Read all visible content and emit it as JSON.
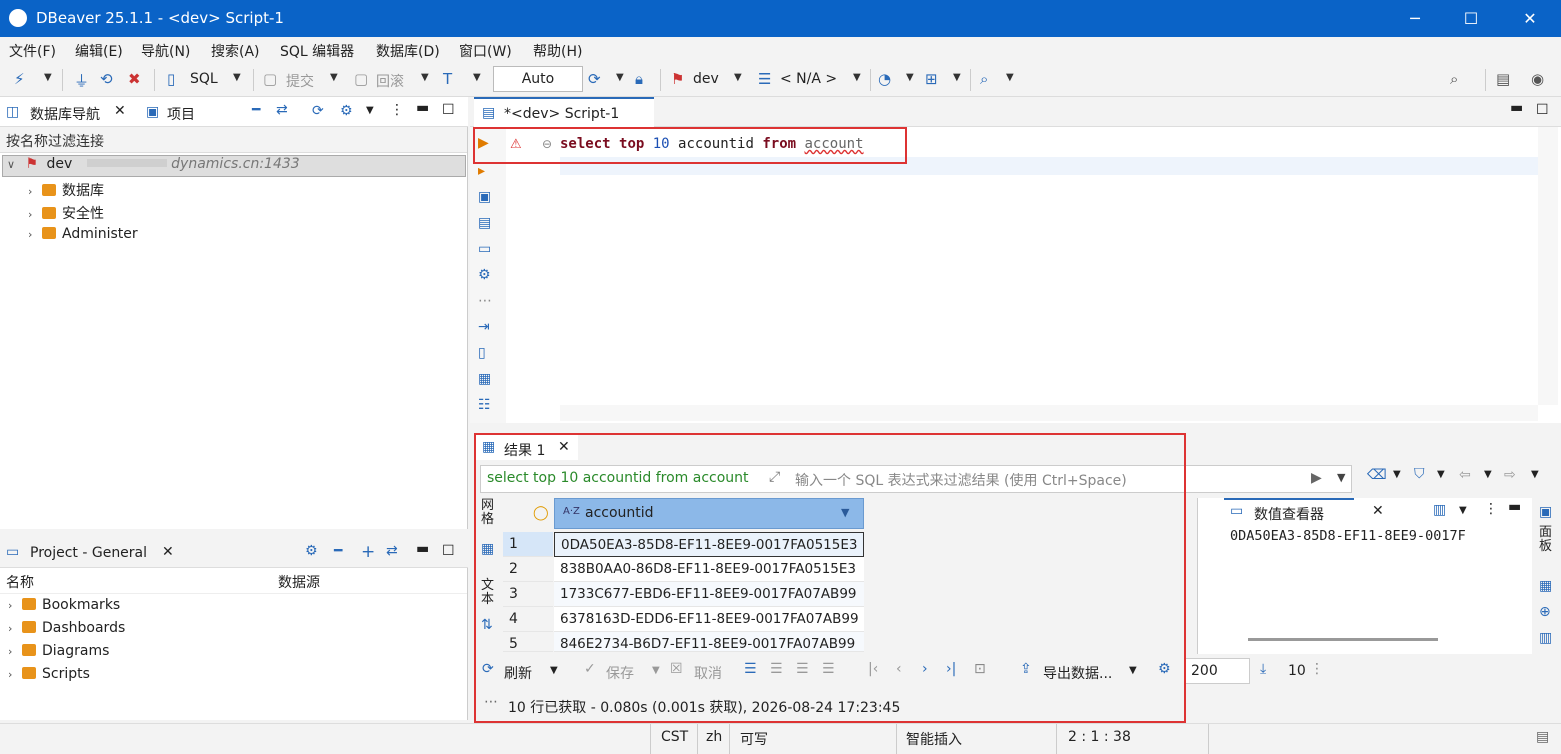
{
  "window": {
    "title": "DBeaver 25.1.1 - <dev> Script-1",
    "minimize": "─",
    "maximize": "☐",
    "close": "✕"
  },
  "menu": [
    "文件(F)",
    "编辑(E)",
    "导航(N)",
    "搜索(A)",
    "SQL 编辑器",
    "数据库(D)",
    "窗口(W)",
    "帮助(H)"
  ],
  "toolbar": {
    "sql": "SQL",
    "commit": "提交",
    "rollback": "回滚",
    "auto": "Auto",
    "datasource": "dev",
    "schema": "< N/A >"
  },
  "navigator": {
    "tab_db": "数据库导航",
    "tab_project": "项目",
    "filter_placeholder": "按名称过滤连接",
    "connection_name": "dev",
    "connection_host": "dynamics.cn:1433",
    "tree": [
      "数据库",
      "安全性",
      "Administer"
    ]
  },
  "project": {
    "tab": "Project - General",
    "col_name": "名称",
    "col_source": "数据源",
    "items": [
      "Bookmarks",
      "Dashboards",
      "Diagrams",
      "Scripts"
    ]
  },
  "editor": {
    "tab": "*<dev> Script-1",
    "sql": {
      "kw1": "select",
      "kw2": "top",
      "num": "10",
      "col": "accountid",
      "kw3": "from",
      "table": "account"
    }
  },
  "results": {
    "tab": "结果 1",
    "query": "select top 10 accountid from account",
    "filter_placeholder": "输入一个 SQL 表达式来过滤结果 (使用 Ctrl+Space)",
    "side_grid": "网格",
    "side_text": "文本",
    "column": "accountid",
    "rows": [
      {
        "n": "1",
        "v": "0DA50EA3-85D8-EF11-8EE9-0017FA0515E3"
      },
      {
        "n": "2",
        "v": "838B0AA0-86D8-EF11-8EE9-0017FA0515E3"
      },
      {
        "n": "3",
        "v": "1733C677-EBD6-EF11-8EE9-0017FA07AB99"
      },
      {
        "n": "4",
        "v": "6378163D-EDD6-EF11-8EE9-0017FA07AB99"
      },
      {
        "n": "5",
        "v": "846E2734-B6D7-EF11-8EE9-0017FA07AB99"
      }
    ],
    "value_viewer": "数值查看器",
    "value_text": "0DA50EA3-85D8-EF11-8EE9-0017F",
    "panel_label": "面板",
    "refresh": "刷新",
    "save": "保存",
    "cancel": "取消",
    "export": "导出数据...",
    "fetch_size": "200",
    "row_count": "10",
    "status": "10 行已获取 - 0.080s (0.001s 获取), 2026-08-24 17:23:45"
  },
  "statusbar": {
    "tz": "CST",
    "locale": "zh",
    "mode": "可写",
    "insert": "智能插入",
    "position": "2 : 1 : 38"
  }
}
